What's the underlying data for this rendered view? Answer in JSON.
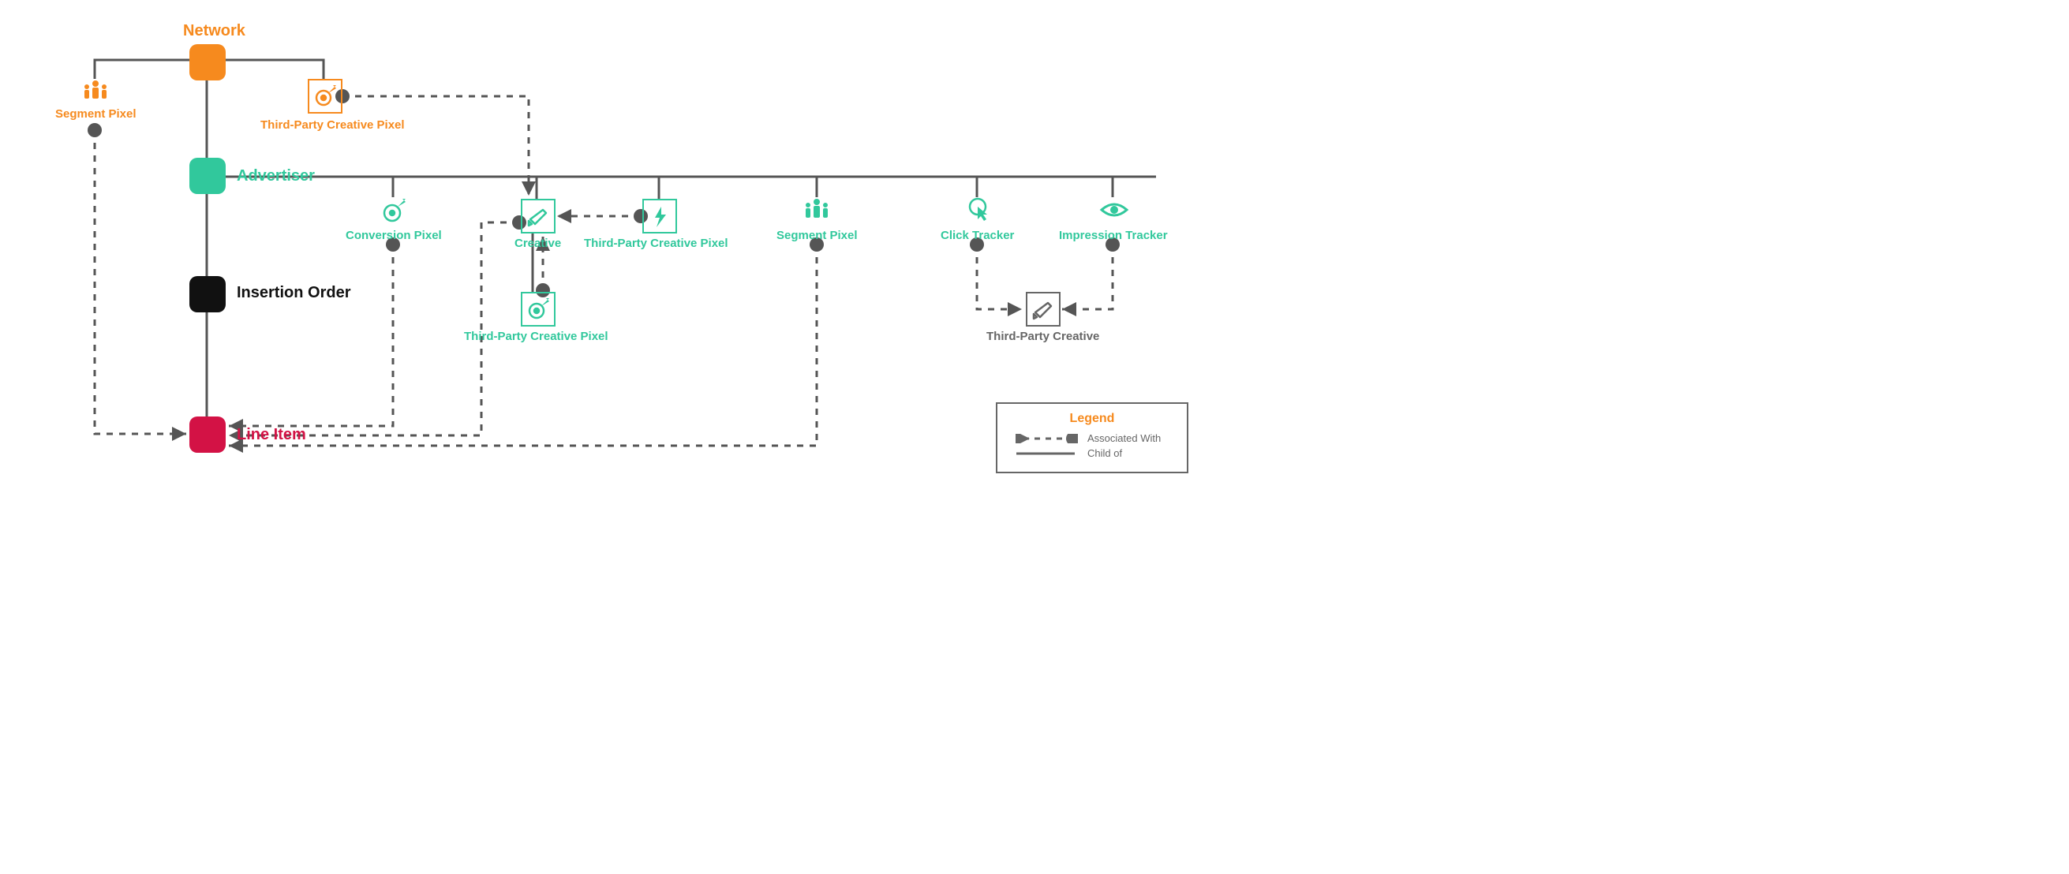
{
  "hierarchy": {
    "network": {
      "label": "Network",
      "color": "orange"
    },
    "advertiser": {
      "label": "Advertiser",
      "color": "green"
    },
    "io": {
      "label": "Insertion Order",
      "color": "black"
    },
    "line_item": {
      "label": "Line Item",
      "color": "red"
    }
  },
  "nodes": {
    "segment_pixel_net": {
      "label": "Segment Pixel",
      "icon": "people",
      "color": "orange"
    },
    "tpcp_net": {
      "label": "Third-Party Creative Pixel",
      "icon": "target",
      "color": "orange"
    },
    "conversion_pixel": {
      "label": "Conversion Pixel",
      "icon": "target",
      "color": "green"
    },
    "creative": {
      "label": "Creative",
      "icon": "megaphone",
      "color": "green"
    },
    "tpcp_adv": {
      "label": "Third-Party Creative Pixel",
      "icon": "bolt",
      "color": "green"
    },
    "tpcp_creative": {
      "label": "Third-Party Creative Pixel",
      "icon": "target",
      "color": "green"
    },
    "segment_pixel_adv": {
      "label": "Segment Pixel",
      "icon": "people",
      "color": "green"
    },
    "click_tracker": {
      "label": "Click Tracker",
      "icon": "click",
      "color": "green"
    },
    "impression_tracker": {
      "label": "Impression Tracker",
      "icon": "eye",
      "color": "green"
    },
    "third_party_creative": {
      "label": "Third-Party Creative",
      "icon": "megaphone",
      "color": "gray"
    }
  },
  "legend": {
    "title": "Legend",
    "assoc": "Associated With",
    "child": "Child of"
  },
  "relationships": {
    "child_of": [
      [
        "advertiser",
        "network"
      ],
      [
        "io",
        "advertiser"
      ],
      [
        "line_item",
        "io"
      ],
      [
        "segment_pixel_net",
        "network"
      ],
      [
        "tpcp_net",
        "network"
      ],
      [
        "conversion_pixel",
        "advertiser"
      ],
      [
        "creative",
        "advertiser"
      ],
      [
        "tpcp_adv",
        "advertiser"
      ],
      [
        "segment_pixel_adv",
        "advertiser"
      ],
      [
        "click_tracker",
        "advertiser"
      ],
      [
        "impression_tracker",
        "advertiser"
      ],
      [
        "tpcp_creative",
        "creative"
      ]
    ],
    "associated_with": [
      [
        "segment_pixel_net",
        "line_item"
      ],
      [
        "tpcp_net",
        "creative"
      ],
      [
        "conversion_pixel",
        "line_item"
      ],
      [
        "creative",
        "line_item"
      ],
      [
        "tpcp_adv",
        "creative"
      ],
      [
        "tpcp_creative",
        "creative"
      ],
      [
        "segment_pixel_adv",
        "line_item"
      ],
      [
        "click_tracker",
        "third_party_creative"
      ],
      [
        "impression_tracker",
        "third_party_creative"
      ]
    ]
  }
}
